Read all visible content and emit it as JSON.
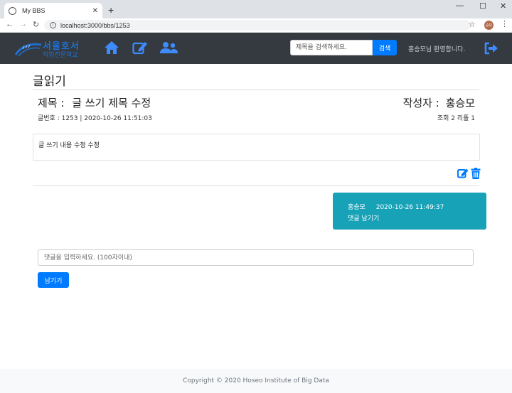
{
  "browser": {
    "tab_title": "My BBS",
    "tab_close": "✕",
    "new_tab": "+",
    "minimize": "—",
    "maximize": "☐",
    "close": "✕",
    "back": "←",
    "forward": "→",
    "reload": "↻",
    "url": "localhost:3000/bbs/1253",
    "star": "☆",
    "profile_initials": "승모",
    "menu": "⋮"
  },
  "navbar": {
    "logo_line1": "서울호서",
    "logo_line2": "직업전문학교",
    "search_placeholder": "제목을 검색하세요.",
    "search_button": "검색",
    "welcome": "홍승모님 환영합니다.",
    "icons": [
      "home-icon",
      "edit-icon",
      "users-icon",
      "logout-icon"
    ],
    "icon_color": "#3d8bfd",
    "bg_color": "#343a40"
  },
  "post": {
    "page_title": "글읽기",
    "title_label": "제목 :",
    "title": "글 쓰기 제목 수정",
    "author_label": "작성자 :",
    "author": "홍승모",
    "meta": "글번호 : 1253 | 2020-10-26 11:51:03",
    "stats": "조회 2 리플 1",
    "content": "글 쓰기 내용 수정 수정"
  },
  "comments": [
    {
      "author": "홍승모",
      "date": "2020-10-26 11:49:37",
      "text": "댓글 남기기"
    }
  ],
  "comment_form": {
    "placeholder": "댓글을 입력하세요. (100자이내)",
    "submit_label": "남기기"
  },
  "footer": {
    "copyright": "Copyright © 2020 Hoseo Institute of Big Data"
  },
  "colors": {
    "primary": "#007bff",
    "comment_bg": "#17a2b8",
    "footer_bg": "#f8f9fa"
  }
}
